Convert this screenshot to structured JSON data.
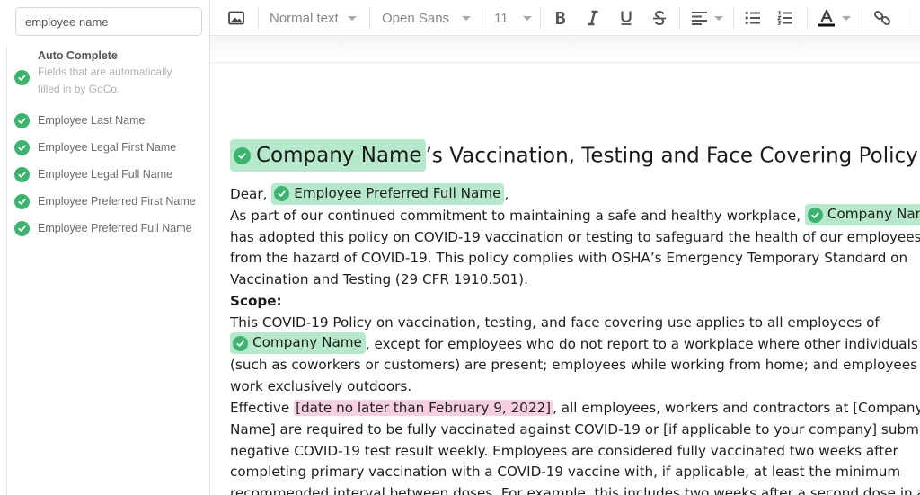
{
  "sidebar": {
    "search_value": "employee name",
    "auto_complete_title": "Auto Complete",
    "auto_complete_desc_1": "Fields that are automatically",
    "auto_complete_desc_2": "filled in by GoCo.",
    "fields": [
      "Employee Last Name",
      "Employee Legal First Name",
      "Employee Legal Full Name",
      "Employee Preferred First Name",
      "Employee Preferred Full Name"
    ]
  },
  "toolbar": {
    "style_select": "Normal text",
    "font_select": "Open Sans",
    "size_select": "11"
  },
  "document": {
    "title_chip": "Company Name",
    "title_rest": "’s Vaccination, Testing and Face Covering Policy",
    "dear": "Dear,",
    "dear_chip": "Employee Preferred Full Name",
    "dear_comma": ",",
    "p1_l1": "As part of our continued commitment to maintaining a safe and healthy workplace,",
    "p1_chip": "Company Name",
    "p1_l2": "has adopted this policy on COVID-19 vaccination or testing to safeguard the health of our employees",
    "p1_l3": "from the hazard of COVID-19. This policy complies with OSHA’s Emergency Temporary Standard on",
    "p1_l4": "Vaccination and Testing (29 CFR 1910.501).",
    "scope_heading": "Scope:",
    "p2_l1": "This COVID-19 Policy on vaccination, testing, and face covering use applies to all employees of",
    "p2_chip": "Company Name",
    "p2_l2": ", except for employees who do not report to a workplace where other individuals",
    "p2_l3": "(such as coworkers or customers) are present; employees while working from home; and employees who",
    "p2_l4": "work exclusively outdoors.",
    "p3_effective": "Effective",
    "p3_date": "[date no later than February 9, 2022]",
    "p3_l1_rest": ", all employees, workers and contractors at [Company",
    "p3_l2": "Name] are required to be fully vaccinated against COVID-19 or [if applicable to your company] submit a",
    "p3_l3": "negative COVID-19 test result weekly. Employees are considered fully vaccinated two weeks after",
    "p3_l4": "completing primary vaccination with a COVID-19 vaccine with, if applicable, at least the minimum",
    "p3_l5": "recommended interval between doses. For example, this includes two weeks after a second dose in a"
  },
  "colors": {
    "chip_green": "#b6e9cb",
    "check_green": "#3cb46e",
    "highlight_pink": "#f7cfe0"
  }
}
